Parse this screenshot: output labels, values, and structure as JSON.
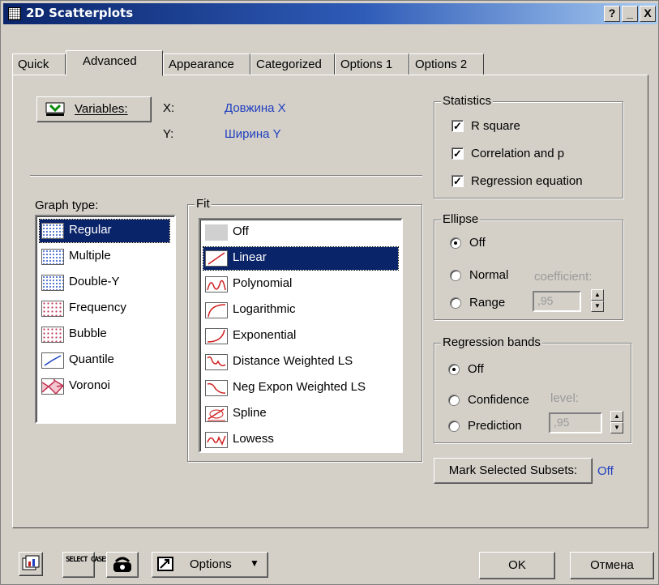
{
  "window": {
    "title": "2D Scatterplots",
    "controls": [
      "?",
      "_",
      "X"
    ]
  },
  "tabs": [
    {
      "label": "Quick",
      "active": false
    },
    {
      "label": "Advanced",
      "active": true
    },
    {
      "label": "Appearance",
      "active": false
    },
    {
      "label": "Categorized",
      "active": false
    },
    {
      "label": "Options 1",
      "active": false
    },
    {
      "label": "Options 2",
      "active": false
    }
  ],
  "variables": {
    "button_label": "Variables:",
    "x_label": "X:",
    "x_value": "Довжина X",
    "y_label": "Y:",
    "y_value": "Ширина Y"
  },
  "graph_type": {
    "label": "Graph type:",
    "items": [
      {
        "label": "Regular",
        "icon": "scatter-regular-icon",
        "selected": true
      },
      {
        "label": "Multiple",
        "icon": "scatter-multiple-icon",
        "selected": false
      },
      {
        "label": "Double-Y",
        "icon": "scatter-double-y-icon",
        "selected": false
      },
      {
        "label": "Frequency",
        "icon": "scatter-frequency-icon",
        "selected": false
      },
      {
        "label": "Bubble",
        "icon": "scatter-bubble-icon",
        "selected": false
      },
      {
        "label": "Quantile",
        "icon": "scatter-quantile-icon",
        "selected": false
      },
      {
        "label": "Voronoi",
        "icon": "scatter-voronoi-icon",
        "selected": false
      }
    ]
  },
  "fit": {
    "label": "Fit",
    "items": [
      {
        "label": "Off",
        "icon": "fit-off-icon",
        "selected": false
      },
      {
        "label": "Linear",
        "icon": "fit-linear-icon",
        "selected": true
      },
      {
        "label": "Polynomial",
        "icon": "fit-polynomial-icon",
        "selected": false
      },
      {
        "label": "Logarithmic",
        "icon": "fit-logarithmic-icon",
        "selected": false
      },
      {
        "label": "Exponential",
        "icon": "fit-exponential-icon",
        "selected": false
      },
      {
        "label": "Distance Weighted LS",
        "icon": "fit-distance-weighted-icon",
        "selected": false
      },
      {
        "label": "Neg Expon Weighted LS",
        "icon": "fit-neg-expon-icon",
        "selected": false
      },
      {
        "label": "Spline",
        "icon": "fit-spline-icon",
        "selected": false
      },
      {
        "label": "Lowess",
        "icon": "fit-lowess-icon",
        "selected": false
      }
    ]
  },
  "statistics": {
    "label": "Statistics",
    "items": [
      {
        "label": "R square",
        "checked": true
      },
      {
        "label": "Correlation and p",
        "checked": true
      },
      {
        "label": "Regression equation",
        "checked": true
      }
    ]
  },
  "ellipse": {
    "label": "Ellipse",
    "options": [
      {
        "label": "Off",
        "selected": true
      },
      {
        "label": "Normal",
        "selected": false
      },
      {
        "label": "Range",
        "selected": false
      }
    ],
    "coefficient_label": "coefficient:",
    "coefficient_value": ",95"
  },
  "regression_bands": {
    "label": "Regression bands",
    "options": [
      {
        "label": "Off",
        "selected": true
      },
      {
        "label": "Confidence",
        "selected": false
      },
      {
        "label": "Prediction",
        "selected": false
      }
    ],
    "level_label": "level:",
    "level_value": ",95"
  },
  "mark_subsets": {
    "button_label": "Mark Selected Subsets:",
    "value": "Off"
  },
  "bottom": {
    "select_cases": "SELECT CASES",
    "options_label": "Options",
    "ok_label": "OK",
    "cancel_label": "Отмена"
  },
  "colors": {
    "title_start": "#0a246a",
    "title_end": "#a6caf0",
    "face": "#d4d0c8",
    "link_blue": "#1f3fbf",
    "selection": "#0a246a"
  }
}
